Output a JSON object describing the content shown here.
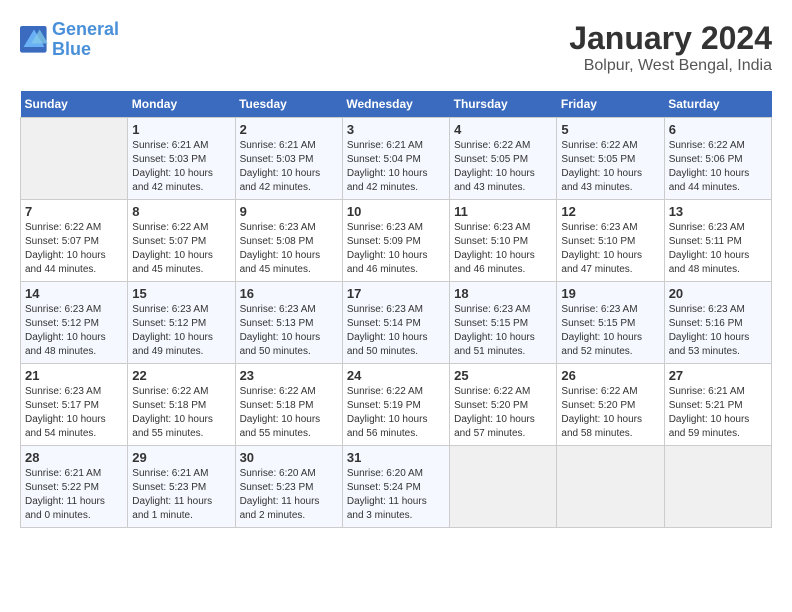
{
  "header": {
    "logo_line1": "General",
    "logo_line2": "Blue",
    "month_title": "January 2024",
    "subtitle": "Bolpur, West Bengal, India"
  },
  "weekdays": [
    "Sunday",
    "Monday",
    "Tuesday",
    "Wednesday",
    "Thursday",
    "Friday",
    "Saturday"
  ],
  "weeks": [
    [
      {
        "day": "",
        "sunrise": "",
        "sunset": "",
        "daylight": ""
      },
      {
        "day": "1",
        "sunrise": "Sunrise: 6:21 AM",
        "sunset": "Sunset: 5:03 PM",
        "daylight": "Daylight: 10 hours and 42 minutes."
      },
      {
        "day": "2",
        "sunrise": "Sunrise: 6:21 AM",
        "sunset": "Sunset: 5:03 PM",
        "daylight": "Daylight: 10 hours and 42 minutes."
      },
      {
        "day": "3",
        "sunrise": "Sunrise: 6:21 AM",
        "sunset": "Sunset: 5:04 PM",
        "daylight": "Daylight: 10 hours and 42 minutes."
      },
      {
        "day": "4",
        "sunrise": "Sunrise: 6:22 AM",
        "sunset": "Sunset: 5:05 PM",
        "daylight": "Daylight: 10 hours and 43 minutes."
      },
      {
        "day": "5",
        "sunrise": "Sunrise: 6:22 AM",
        "sunset": "Sunset: 5:05 PM",
        "daylight": "Daylight: 10 hours and 43 minutes."
      },
      {
        "day": "6",
        "sunrise": "Sunrise: 6:22 AM",
        "sunset": "Sunset: 5:06 PM",
        "daylight": "Daylight: 10 hours and 44 minutes."
      }
    ],
    [
      {
        "day": "7",
        "sunrise": "Sunrise: 6:22 AM",
        "sunset": "Sunset: 5:07 PM",
        "daylight": "Daylight: 10 hours and 44 minutes."
      },
      {
        "day": "8",
        "sunrise": "Sunrise: 6:22 AM",
        "sunset": "Sunset: 5:07 PM",
        "daylight": "Daylight: 10 hours and 45 minutes."
      },
      {
        "day": "9",
        "sunrise": "Sunrise: 6:23 AM",
        "sunset": "Sunset: 5:08 PM",
        "daylight": "Daylight: 10 hours and 45 minutes."
      },
      {
        "day": "10",
        "sunrise": "Sunrise: 6:23 AM",
        "sunset": "Sunset: 5:09 PM",
        "daylight": "Daylight: 10 hours and 46 minutes."
      },
      {
        "day": "11",
        "sunrise": "Sunrise: 6:23 AM",
        "sunset": "Sunset: 5:10 PM",
        "daylight": "Daylight: 10 hours and 46 minutes."
      },
      {
        "day": "12",
        "sunrise": "Sunrise: 6:23 AM",
        "sunset": "Sunset: 5:10 PM",
        "daylight": "Daylight: 10 hours and 47 minutes."
      },
      {
        "day": "13",
        "sunrise": "Sunrise: 6:23 AM",
        "sunset": "Sunset: 5:11 PM",
        "daylight": "Daylight: 10 hours and 48 minutes."
      }
    ],
    [
      {
        "day": "14",
        "sunrise": "Sunrise: 6:23 AM",
        "sunset": "Sunset: 5:12 PM",
        "daylight": "Daylight: 10 hours and 48 minutes."
      },
      {
        "day": "15",
        "sunrise": "Sunrise: 6:23 AM",
        "sunset": "Sunset: 5:12 PM",
        "daylight": "Daylight: 10 hours and 49 minutes."
      },
      {
        "day": "16",
        "sunrise": "Sunrise: 6:23 AM",
        "sunset": "Sunset: 5:13 PM",
        "daylight": "Daylight: 10 hours and 50 minutes."
      },
      {
        "day": "17",
        "sunrise": "Sunrise: 6:23 AM",
        "sunset": "Sunset: 5:14 PM",
        "daylight": "Daylight: 10 hours and 50 minutes."
      },
      {
        "day": "18",
        "sunrise": "Sunrise: 6:23 AM",
        "sunset": "Sunset: 5:15 PM",
        "daylight": "Daylight: 10 hours and 51 minutes."
      },
      {
        "day": "19",
        "sunrise": "Sunrise: 6:23 AM",
        "sunset": "Sunset: 5:15 PM",
        "daylight": "Daylight: 10 hours and 52 minutes."
      },
      {
        "day": "20",
        "sunrise": "Sunrise: 6:23 AM",
        "sunset": "Sunset: 5:16 PM",
        "daylight": "Daylight: 10 hours and 53 minutes."
      }
    ],
    [
      {
        "day": "21",
        "sunrise": "Sunrise: 6:23 AM",
        "sunset": "Sunset: 5:17 PM",
        "daylight": "Daylight: 10 hours and 54 minutes."
      },
      {
        "day": "22",
        "sunrise": "Sunrise: 6:22 AM",
        "sunset": "Sunset: 5:18 PM",
        "daylight": "Daylight: 10 hours and 55 minutes."
      },
      {
        "day": "23",
        "sunrise": "Sunrise: 6:22 AM",
        "sunset": "Sunset: 5:18 PM",
        "daylight": "Daylight: 10 hours and 55 minutes."
      },
      {
        "day": "24",
        "sunrise": "Sunrise: 6:22 AM",
        "sunset": "Sunset: 5:19 PM",
        "daylight": "Daylight: 10 hours and 56 minutes."
      },
      {
        "day": "25",
        "sunrise": "Sunrise: 6:22 AM",
        "sunset": "Sunset: 5:20 PM",
        "daylight": "Daylight: 10 hours and 57 minutes."
      },
      {
        "day": "26",
        "sunrise": "Sunrise: 6:22 AM",
        "sunset": "Sunset: 5:20 PM",
        "daylight": "Daylight: 10 hours and 58 minutes."
      },
      {
        "day": "27",
        "sunrise": "Sunrise: 6:21 AM",
        "sunset": "Sunset: 5:21 PM",
        "daylight": "Daylight: 10 hours and 59 minutes."
      }
    ],
    [
      {
        "day": "28",
        "sunrise": "Sunrise: 6:21 AM",
        "sunset": "Sunset: 5:22 PM",
        "daylight": "Daylight: 11 hours and 0 minutes."
      },
      {
        "day": "29",
        "sunrise": "Sunrise: 6:21 AM",
        "sunset": "Sunset: 5:23 PM",
        "daylight": "Daylight: 11 hours and 1 minute."
      },
      {
        "day": "30",
        "sunrise": "Sunrise: 6:20 AM",
        "sunset": "Sunset: 5:23 PM",
        "daylight": "Daylight: 11 hours and 2 minutes."
      },
      {
        "day": "31",
        "sunrise": "Sunrise: 6:20 AM",
        "sunset": "Sunset: 5:24 PM",
        "daylight": "Daylight: 11 hours and 3 minutes."
      },
      {
        "day": "",
        "sunrise": "",
        "sunset": "",
        "daylight": ""
      },
      {
        "day": "",
        "sunrise": "",
        "sunset": "",
        "daylight": ""
      },
      {
        "day": "",
        "sunrise": "",
        "sunset": "",
        "daylight": ""
      }
    ]
  ]
}
